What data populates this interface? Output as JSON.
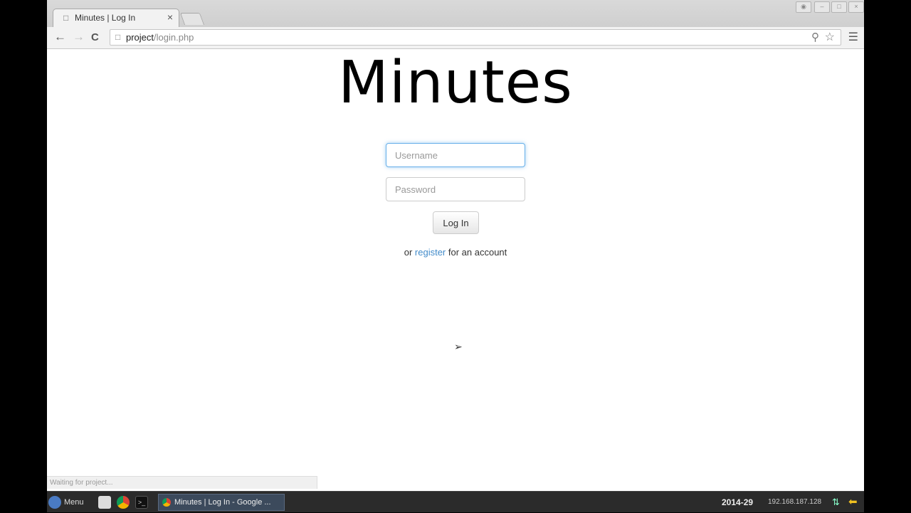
{
  "browser": {
    "tab": {
      "title": "Minutes | Log In",
      "close": "×",
      "icon": "page-icon"
    },
    "address": {
      "host": "project",
      "path": "/login.php"
    },
    "nav": {
      "back": "←",
      "forward": "→",
      "reload": "C"
    },
    "icons": {
      "zoom": "zoom-icon",
      "bookmark": "star-icon",
      "menu": "menu-icon"
    }
  },
  "page": {
    "title": "Minutes",
    "username_placeholder": "Username",
    "password_placeholder": "Password",
    "login_label": "Log In",
    "register_prefix": "or",
    "register_link": "register",
    "register_suffix": "for an account",
    "status_text": "Waiting for project..."
  },
  "taskbar": {
    "menu_label": "Menu",
    "window_title": "Minutes | Log In - Google ...",
    "week": "2014-29",
    "ip": "192.168.187.128"
  },
  "colors": {
    "link": "#428bca",
    "focus": "#66afe9",
    "taskbar": "#2b2b2b"
  }
}
